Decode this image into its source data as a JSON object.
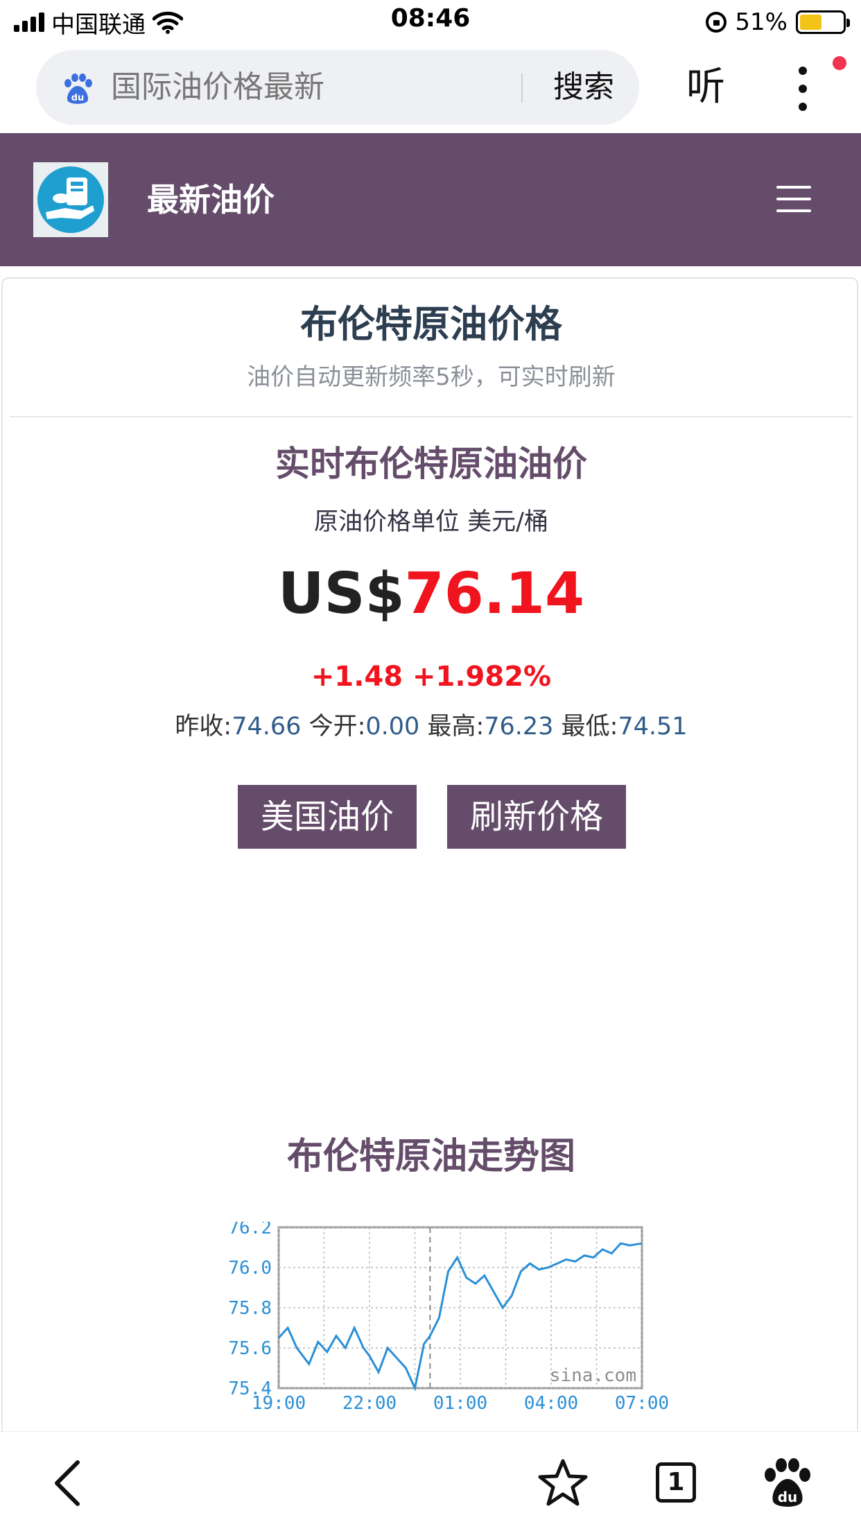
{
  "status_bar": {
    "carrier": "中国联通",
    "time": "08:46",
    "battery": "51%",
    "battery_level": 0.51
  },
  "browser": {
    "search_query": "国际油价格最新",
    "search_button": "搜索",
    "listen_button": "听"
  },
  "site": {
    "title": "最新油价"
  },
  "card": {
    "title": "布伦特原油价格",
    "subtitle": "油价自动更新频率5秒，可实时刷新",
    "live_title": "实时布伦特原油油价",
    "unit_line": "原油价格单位 美元/桶",
    "currency": "US$",
    "price": "76.14",
    "change": "+1.48 +1.982%",
    "stats": {
      "prev_close_label": "昨收:",
      "prev_close": "74.66",
      "open_label": "今开:",
      "open": "0.00",
      "high_label": "最高:",
      "high": "76.23",
      "low_label": "最低:",
      "low": "74.51"
    },
    "buttons": {
      "us_oil": "美国油价",
      "refresh": "刷新价格"
    },
    "trend_title": "布伦特原油走势图"
  },
  "chart_data": {
    "type": "line",
    "yticks": [
      "76.2",
      "76.0",
      "75.8",
      "75.6",
      "75.4"
    ],
    "xticks": [
      "19:00",
      "22:00",
      "01:00",
      "04:00",
      "07:00"
    ],
    "watermark": "sina.com",
    "ylim": [
      75.4,
      76.2
    ],
    "xlim": [
      19,
      31
    ],
    "grid": true,
    "color": "#2a8fd6",
    "x": [
      19.0,
      19.3,
      19.6,
      20.0,
      20.3,
      20.6,
      20.9,
      21.2,
      21.5,
      21.8,
      22.0,
      22.3,
      22.6,
      22.9,
      23.2,
      23.5,
      23.8,
      24.0,
      24.3,
      24.6,
      24.9,
      25.2,
      25.5,
      25.8,
      26.1,
      26.4,
      26.7,
      27.0,
      27.3,
      27.6,
      27.9,
      28.2,
      28.5,
      28.8,
      29.1,
      29.4,
      29.7,
      30.0,
      30.3,
      30.6,
      31.0
    ],
    "y": [
      75.65,
      75.7,
      75.6,
      75.52,
      75.63,
      75.58,
      75.66,
      75.6,
      75.7,
      75.6,
      75.56,
      75.48,
      75.6,
      75.55,
      75.5,
      75.4,
      75.62,
      75.66,
      75.75,
      75.98,
      76.05,
      75.95,
      75.92,
      75.96,
      75.88,
      75.8,
      75.86,
      75.98,
      76.02,
      75.99,
      76.0,
      76.02,
      76.04,
      76.03,
      76.06,
      76.05,
      76.09,
      76.07,
      76.12,
      76.11,
      76.12
    ]
  },
  "toolbar": {
    "tab_count": "1"
  },
  "colors": {
    "brand": "#644c6a",
    "price_red": "#f0141e",
    "stats_blue": "#2f5b8a",
    "chart_line": "#2a8fd6"
  },
  "icons": [
    "wifi-icon",
    "lock-icon",
    "baidu-icon",
    "menu-icon",
    "back-icon",
    "star-icon",
    "paw-icon"
  ]
}
